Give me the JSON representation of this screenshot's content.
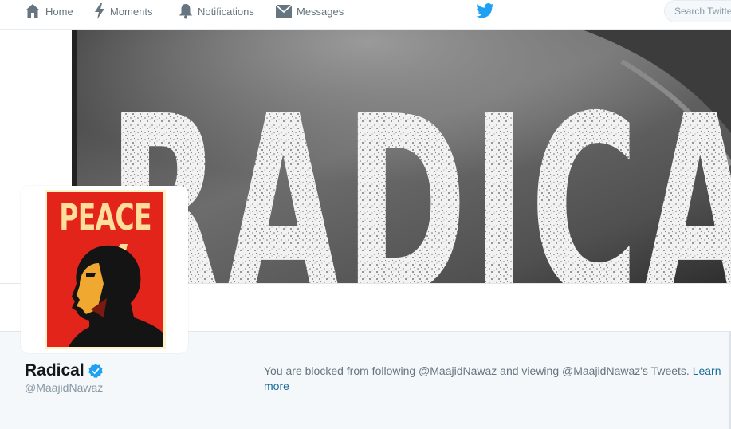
{
  "nav": {
    "home_label": "Home",
    "moments_label": "Moments",
    "notifications_label": "Notifications",
    "messages_label": "Messages",
    "search_placeholder": "Search Twitter"
  },
  "banner": {
    "text": "RADICA"
  },
  "avatar": {
    "text": "PEACE"
  },
  "profile": {
    "name": "Radical",
    "handle": "@MaajidNawaz",
    "blocked_message": "You are blocked from following @MaajidNawaz and viewing @MaajidNawaz's Tweets. ",
    "learn_more": "Learn more"
  },
  "colors": {
    "brand": "#1da1f2",
    "nav_text": "#66757f",
    "avatar_red": "#e2241b",
    "avatar_cream": "#ffdd9a"
  },
  "icons": [
    "home-icon",
    "moments-icon",
    "notifications-icon",
    "messages-icon",
    "twitter-bird-icon",
    "verified-badge-icon"
  ]
}
